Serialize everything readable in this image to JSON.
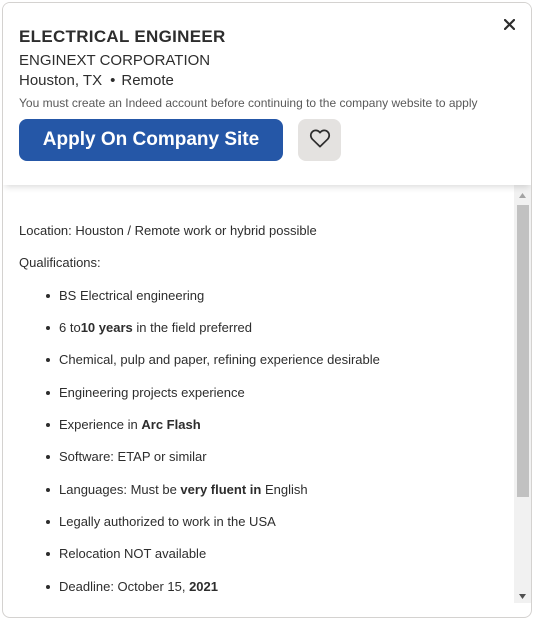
{
  "job": {
    "title": "ELECTRICAL ENGINEER",
    "company": "ENGINEXT CORPORATION",
    "location": "Houston, TX",
    "separator": "•",
    "work_type": "Remote",
    "notice": "You must create an Indeed account before continuing to the company website to apply",
    "apply_label": "Apply On Company Site"
  },
  "icons": {
    "close": "close-icon",
    "save": "heart-icon",
    "scroll_up": "triangle-up-icon",
    "scroll_down": "triangle-down-icon"
  },
  "colors": {
    "apply_button": "#2557a7",
    "save_button_bg": "#e4e2e0",
    "text": "#2d2d2d",
    "muted_text": "#595959"
  },
  "description": {
    "location_line": "Location: Houston / Remote work or hybrid possible",
    "qualifications_heading": "Qualifications:",
    "items": {
      "degree": "BS Electrical engineering",
      "experience_pre": "6 to",
      "experience_bold": "10 years",
      "experience_post": " in the field preferred",
      "industry": "Chemical, pulp and paper, refining experience desirable",
      "projects": "Engineering projects experience",
      "arcflash_pre": "Experience in ",
      "arcflash_bold": "Arc Flash",
      "software": "Software: ETAP or similar",
      "language_pre": "Languages: Must be ",
      "language_bold": "very fluent in",
      "language_post": " English",
      "authorization": "Legally authorized to work in the USA",
      "relocation": "Relocation NOT available",
      "deadline_pre": "Deadline: October 15, ",
      "deadline_bold": "2021"
    }
  }
}
